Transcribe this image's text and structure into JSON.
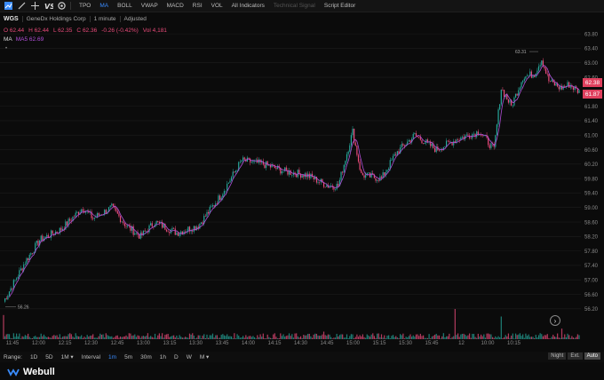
{
  "toolbar": {
    "items": [
      {
        "label": "TPO",
        "active": false
      },
      {
        "label": "MA",
        "active": true
      },
      {
        "label": "BOLL",
        "active": false
      },
      {
        "label": "VWAP",
        "active": false
      },
      {
        "label": "MACD",
        "active": false
      },
      {
        "label": "RSI",
        "active": false
      },
      {
        "label": "VOL",
        "active": false
      },
      {
        "label": "All Indicators",
        "active": false
      },
      {
        "label": "Technical Signal",
        "active": false,
        "dim": true
      },
      {
        "label": "Script Editor",
        "active": false
      }
    ]
  },
  "symbol": {
    "ticker": "WGS",
    "name": "GeneDx Holdings Corp",
    "interval": "1 minute",
    "adjust": "Adjusted"
  },
  "ohlc": {
    "o_label": "O",
    "o": "62.44",
    "h_label": "H",
    "h": "62.44",
    "l_label": "L",
    "l": "62.35",
    "c_label": "C",
    "c": "62.36",
    "chg": "-0.26",
    "chg_pct": "(-0.42%)",
    "vol_label": "Vol",
    "vol": "4,181"
  },
  "ma": {
    "label": "MA",
    "value": "MA5 62.69"
  },
  "colors": {
    "up": "#26a69a",
    "down": "#e94b7a",
    "ma": "#b04fd8",
    "accent": "#3a8cff",
    "last": "#e0405e"
  },
  "price_tags": {
    "last": "62.38",
    "ma": "61.87"
  },
  "chart_data": {
    "type": "candlestick",
    "y_ticks": [
      "63.80",
      "63.40",
      "63.00",
      "62.60",
      "62.20",
      "61.80",
      "61.40",
      "61.00",
      "60.60",
      "60.20",
      "59.80",
      "59.40",
      "59.00",
      "58.60",
      "58.20",
      "57.80",
      "57.40",
      "57.00",
      "56.60",
      "56.20"
    ],
    "x_ticks": [
      "11:45",
      "12:00",
      "12:15",
      "12:30",
      "12:45",
      "13:00",
      "13:15",
      "13:30",
      "13:45",
      "14:00",
      "14:15",
      "14:30",
      "14:45",
      "15:00",
      "15:15",
      "15:30",
      "15:45",
      "12",
      "10:00",
      "10:15"
    ],
    "ylim": [
      55.95,
      63.95
    ],
    "high_marker": "63.31",
    "low_marker": "56.26",
    "keypoints": [
      [
        0,
        56.4
      ],
      [
        15,
        57.5
      ],
      [
        25,
        58.1
      ],
      [
        40,
        58.4
      ],
      [
        55,
        59.0
      ],
      [
        62,
        58.7
      ],
      [
        75,
        59.0
      ],
      [
        85,
        58.5
      ],
      [
        95,
        58.2
      ],
      [
        105,
        58.6
      ],
      [
        120,
        58.3
      ],
      [
        135,
        58.5
      ],
      [
        150,
        59.3
      ],
      [
        165,
        60.3
      ],
      [
        180,
        60.2
      ],
      [
        195,
        60.0
      ],
      [
        210,
        59.9
      ],
      [
        225,
        59.6
      ],
      [
        232,
        59.6
      ],
      [
        242,
        61.1
      ],
      [
        248,
        59.9
      ],
      [
        262,
        59.8
      ],
      [
        272,
        60.5
      ],
      [
        285,
        61.0
      ],
      [
        300,
        60.6
      ],
      [
        315,
        60.9
      ],
      [
        330,
        61.1
      ],
      [
        340,
        60.6
      ],
      [
        345,
        62.3
      ],
      [
        352,
        61.8
      ],
      [
        360,
        62.6
      ],
      [
        368,
        62.7
      ],
      [
        373,
        63.1
      ],
      [
        378,
        62.5
      ],
      [
        386,
        62.3
      ],
      [
        392,
        62.4
      ],
      [
        399,
        62.2
      ]
    ],
    "volume_spikes": [
      [
        0,
        0.8
      ],
      [
        313,
        1.0
      ],
      [
        345,
        0.75
      ],
      [
        387,
        0.35
      ],
      [
        100,
        0.2
      ],
      [
        222,
        0.25
      ]
    ]
  },
  "bottom": {
    "range_label": "Range:",
    "ranges": [
      "1D",
      "5D",
      "1M ▾"
    ],
    "interval_label": "Interval",
    "intervals": [
      {
        "label": "1m",
        "active": true
      },
      {
        "label": "5m",
        "active": false
      },
      {
        "label": "30m",
        "active": false
      },
      {
        "label": "1h",
        "active": false
      },
      {
        "label": "D",
        "active": false
      },
      {
        "label": "W",
        "active": false
      },
      {
        "label": "M ▾",
        "active": false
      }
    ],
    "sessions": [
      {
        "label": "Night",
        "active": false
      },
      {
        "label": "Ext.",
        "active": false
      },
      {
        "label": "Auto",
        "active": true
      }
    ]
  },
  "footer": {
    "brand": "Webull"
  }
}
